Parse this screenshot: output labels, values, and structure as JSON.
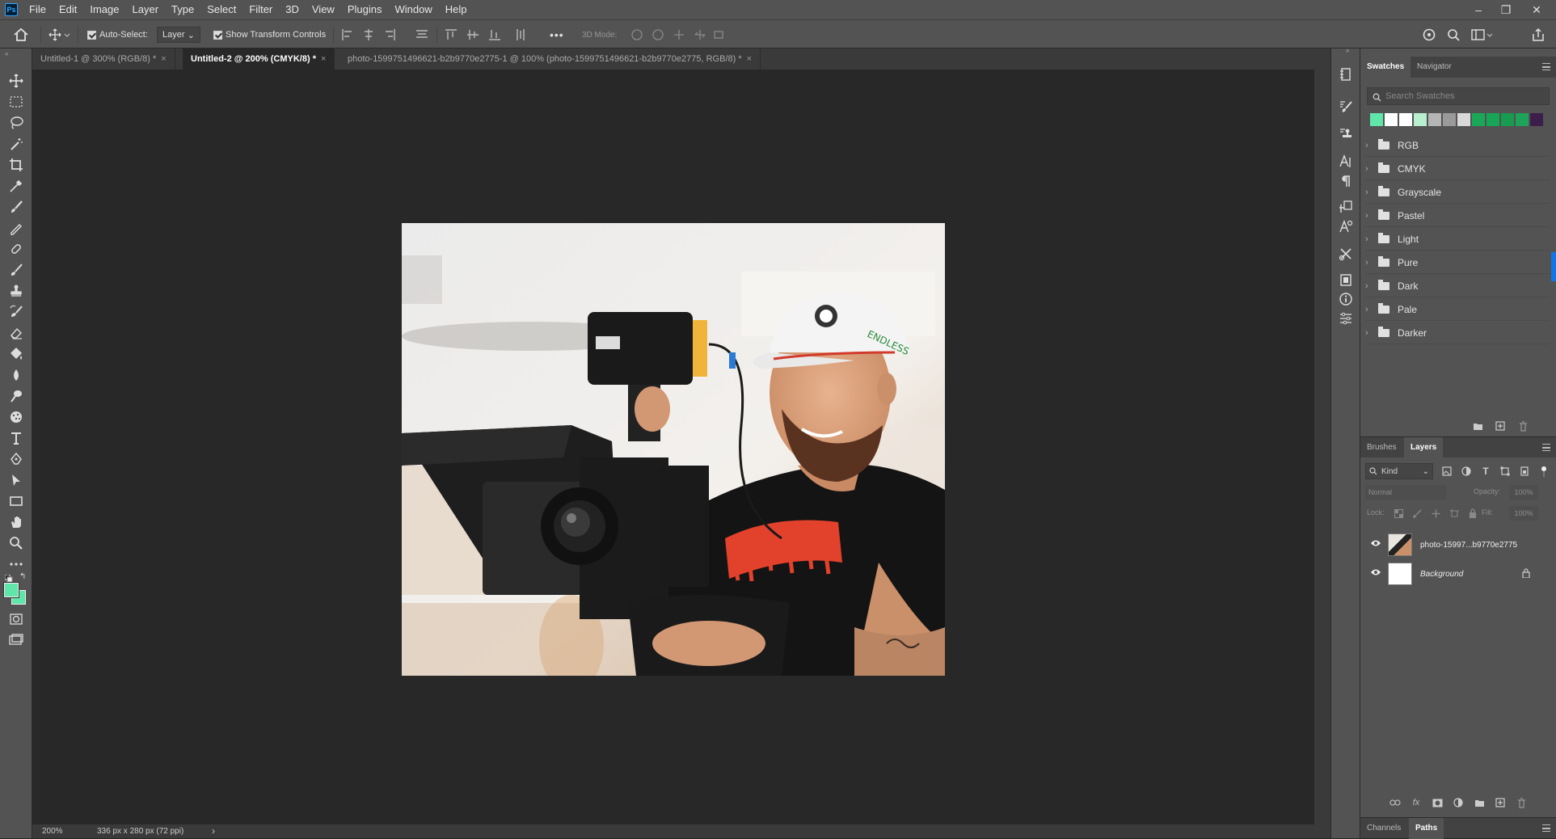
{
  "menu": {
    "logo": "Ps",
    "items": [
      "File",
      "Edit",
      "Image",
      "Layer",
      "Type",
      "Select",
      "Filter",
      "3D",
      "View",
      "Plugins",
      "Window",
      "Help"
    ]
  },
  "window_controls": {
    "minimize": "–",
    "restore": "❐",
    "close": "✕"
  },
  "options_bar": {
    "auto_select_label": "Auto-Select:",
    "auto_select_target": "Layer",
    "show_transform_label": "Show Transform Controls",
    "mode_3d_label": "3D Mode:",
    "more_label": "•••"
  },
  "tabs": [
    {
      "label": "Untitled-1 @ 300% (RGB/8) *",
      "close": "×"
    },
    {
      "label": "Untitled-2 @ 200% (CMYK/8) *",
      "close": "×"
    },
    {
      "label": "photo-1599751496621-b2b9770e2775-1 @ 100% (photo-1599751496621-b2b9770e2775, RGB/8) *",
      "close": "×"
    }
  ],
  "status": {
    "zoom": "200%",
    "doc_info": "336 px x 280 px (72 ppi)",
    "arrow": "›"
  },
  "swatches_panel": {
    "tab_swatches": "Swatches",
    "tab_navigator": "Navigator",
    "search_placeholder": "Search Swatches",
    "recent_colors": [
      "#5fe6a8",
      "#ffffff",
      "#ffffff",
      "#b8f0cf",
      "#b5b5b5",
      "#9a9a9a",
      "#d9d9d9",
      "#1aa858",
      "#17a655",
      "#179b50",
      "#1ea35a",
      "#3b1f4a"
    ],
    "folders": [
      "RGB",
      "CMYK",
      "Grayscale",
      "Pastel",
      "Light",
      "Pure",
      "Dark",
      "Pale",
      "Darker"
    ]
  },
  "layers_panel": {
    "tab_brushes": "Brushes",
    "tab_layers": "Layers",
    "kind_label": "Kind",
    "blend_mode": "Normal",
    "opacity_label": "Opacity:",
    "opacity_value": "100%",
    "lock_label": "Lock:",
    "fill_label": "Fill:",
    "fill_value": "100%",
    "layers": [
      {
        "name": "photo-15997...b9770e2775",
        "visible": true
      },
      {
        "name": "Background",
        "visible": true,
        "locked": true
      }
    ]
  },
  "bottom_panel": {
    "tab_channels": "Channels",
    "tab_paths": "Paths"
  },
  "colors": {
    "foreground": "#5fe6a8",
    "background": "#5fe6a8",
    "accent": "#31a8ff"
  }
}
